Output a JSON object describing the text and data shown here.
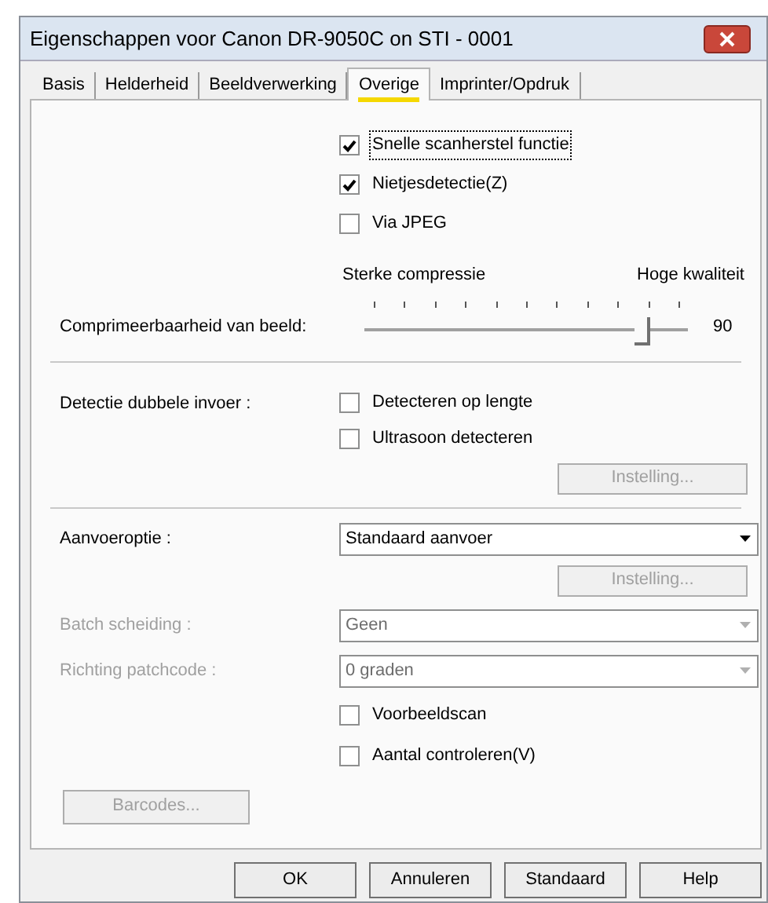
{
  "window": {
    "title": "Eigenschappen voor Canon DR-9050C on STI - 0001"
  },
  "tabs": [
    {
      "label": "Basis",
      "selected": false
    },
    {
      "label": "Helderheid",
      "selected": false
    },
    {
      "label": "Beeldverwerking",
      "selected": false
    },
    {
      "label": "Overige",
      "selected": true
    },
    {
      "label": "Imprinter/Opdruk",
      "selected": false
    }
  ],
  "options": [
    {
      "label": "Snelle scanherstel functie",
      "checked": true,
      "focused": true
    },
    {
      "label": "Nietjesdetectie(Z)",
      "checked": true,
      "focused": false
    },
    {
      "label": "Via JPEG",
      "checked": false,
      "focused": false
    }
  ],
  "compression": {
    "left_caption": "Sterke compressie",
    "right_caption": "Hoge kwaliteit",
    "label": "Comprimeerbaarheid van beeld:",
    "level": 0.9,
    "reading": "90"
  },
  "double_feed": {
    "label": "Detectie dubbele invoer :",
    "options": [
      {
        "label": "Detecteren op lengte",
        "checked": false
      },
      {
        "label": "Ultrasoon detecteren",
        "checked": false
      }
    ],
    "settings_button": {
      "label": "Instelling...",
      "disabled": true
    }
  },
  "feed_option": {
    "label": "Aanvoeroptie :",
    "value": "Standaard aanvoer",
    "disabled": false,
    "settings_button": {
      "label": "Instelling...",
      "disabled": true
    }
  },
  "batch_separation": {
    "label": "Batch scheiding :",
    "value": "Geen",
    "disabled": true
  },
  "patch_direction": {
    "label": "Richting patchcode :",
    "value": "0 graden",
    "disabled": true
  },
  "extra_options": [
    {
      "label": "Voorbeeldscan",
      "checked": false
    },
    {
      "label": "Aantal controleren(V)",
      "checked": false
    }
  ],
  "barcodes_button": {
    "label": "Barcodes...",
    "disabled": true
  },
  "buttons": [
    {
      "label": "OK"
    },
    {
      "label": "Annuleren"
    },
    {
      "label": "Standaard"
    },
    {
      "label": "Help"
    }
  ]
}
